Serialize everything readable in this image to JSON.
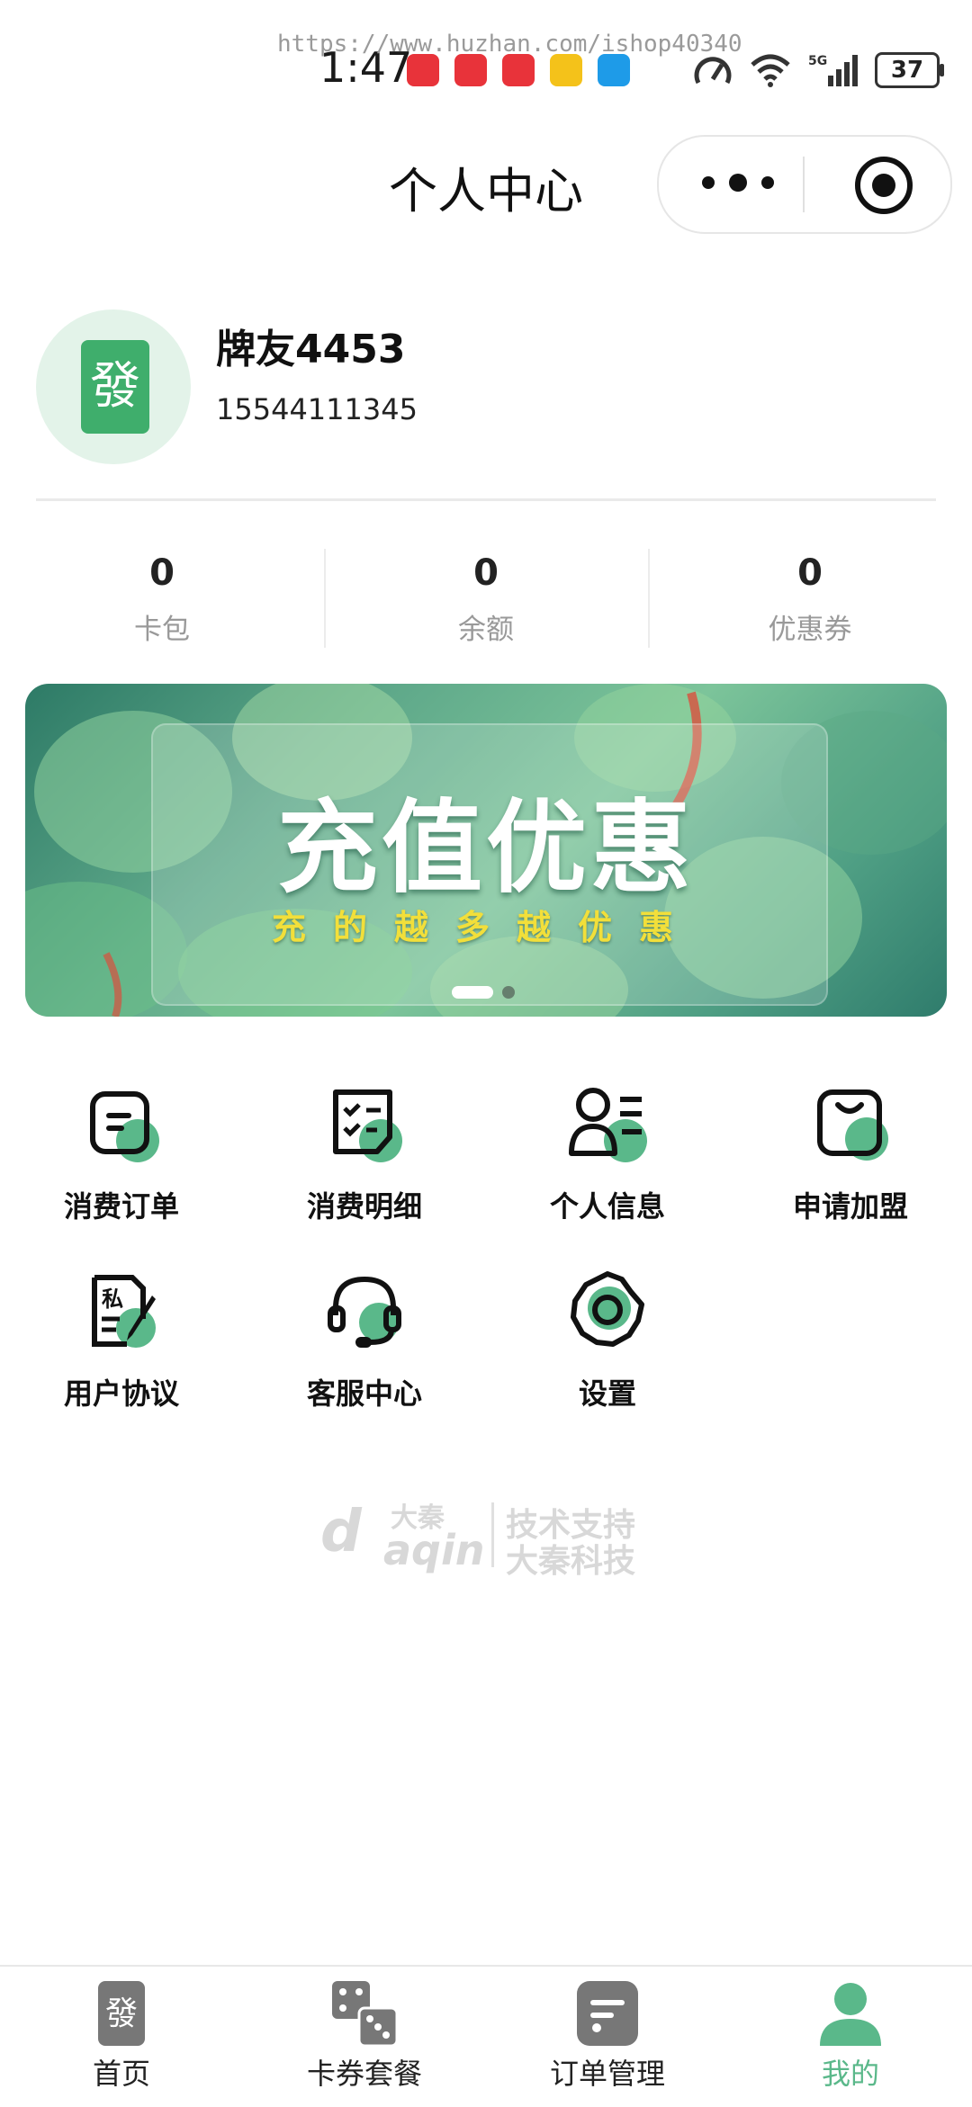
{
  "status_bar": {
    "time": "1:47",
    "watermark": "https://www.huzhan.com/ishop40340",
    "battery": "37",
    "network": "5G"
  },
  "header": {
    "title": "个人中心"
  },
  "profile": {
    "avatar_char": "發",
    "name": "牌友4453",
    "phone": "15544111345"
  },
  "stats": [
    {
      "value": "0",
      "label": "卡包"
    },
    {
      "value": "0",
      "label": "余额"
    },
    {
      "value": "0",
      "label": "优惠券"
    }
  ],
  "banner": {
    "title": "充值优惠",
    "subtitle": "充的越多越优惠",
    "slides": 2,
    "active_slide": 0
  },
  "menu": [
    {
      "label": "消费订单",
      "icon": "order-icon"
    },
    {
      "label": "消费明细",
      "icon": "checklist-icon"
    },
    {
      "label": "个人信息",
      "icon": "profile-card-icon"
    },
    {
      "label": "申请加盟",
      "icon": "bag-icon"
    },
    {
      "label": "用户协议",
      "icon": "agreement-icon"
    },
    {
      "label": "客服中心",
      "icon": "headset-icon"
    },
    {
      "label": "设置",
      "icon": "settings-gear-icon"
    }
  ],
  "footer_brand": {
    "logo_text_cn": "大秦",
    "logo_text_en": "aqin",
    "line1": "技术支持",
    "line2": "大秦科技"
  },
  "tabbar": [
    {
      "label": "首页",
      "icon": "mahjong-tile-icon",
      "active": false
    },
    {
      "label": "卡券套餐",
      "icon": "dice-icon",
      "active": false
    },
    {
      "label": "订单管理",
      "icon": "order-manage-icon",
      "active": false
    },
    {
      "label": "我的",
      "icon": "user-icon",
      "active": true
    }
  ],
  "colors": {
    "accent": "#5ab88a",
    "avatar_bg": "#e3f3e9",
    "tile_green": "#3fae6c",
    "muted_text": "#999999"
  }
}
